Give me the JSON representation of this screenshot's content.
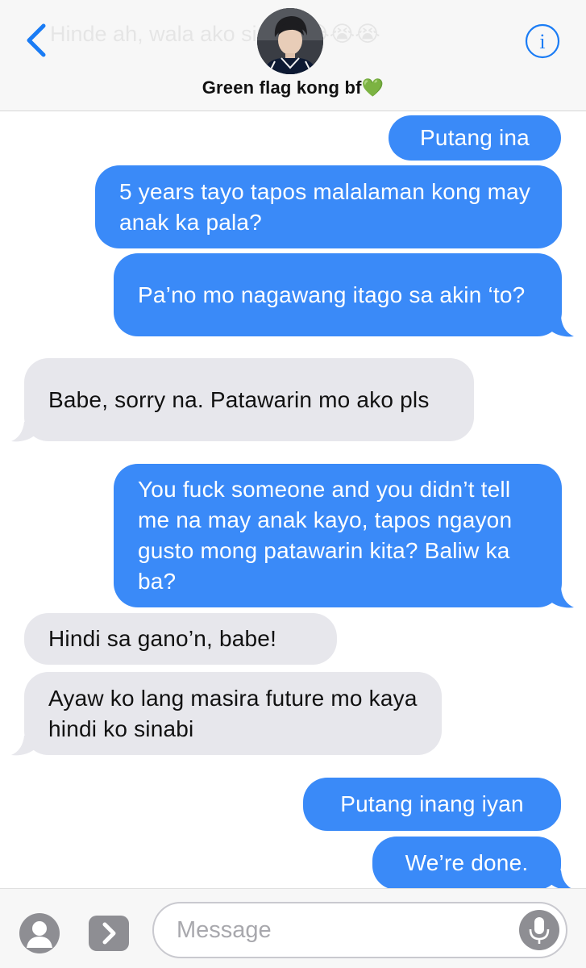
{
  "header": {
    "contact_name": "Green flag kong bf💚",
    "ghost_preview": "Hinde ah, wala ako sinabi 😭😭😭"
  },
  "messages": [
    {
      "id": 0,
      "side": "sent",
      "text": "Putang ina"
    },
    {
      "id": 1,
      "side": "sent",
      "text": "5 years tayo tapos malalaman kong may anak ka pala?"
    },
    {
      "id": 2,
      "side": "sent",
      "text": "Pa’no mo nagawang itago sa akin ‘to?"
    },
    {
      "id": 3,
      "side": "received",
      "text": "Babe, sorry na. Patawarin mo ako pls"
    },
    {
      "id": 4,
      "side": "sent",
      "text": "You fuck someone and you didn’t tell me na may anak kayo, tapos ngayon gusto mong patawarin kita? Baliw ka ba?"
    },
    {
      "id": 5,
      "side": "received",
      "text": "Hindi sa gano’n, babe!"
    },
    {
      "id": 6,
      "side": "received",
      "text": "Ayaw ko lang masira future mo kaya hindi ko sinabi"
    },
    {
      "id": 7,
      "side": "sent",
      "text": "Putang inang iyan"
    },
    {
      "id": 8,
      "side": "sent",
      "text": "We’re done."
    }
  ],
  "input": {
    "placeholder": "Message",
    "value": ""
  },
  "icons": {
    "back": "chevron-left-icon",
    "info": "info-icon",
    "camera": "camera-icon",
    "apps": "app-drawer-icon",
    "mic": "microphone-icon"
  },
  "colors": {
    "sent_bubble": "#3a8af8",
    "received_bubble": "#e7e7ec",
    "accent": "#1a7cf5"
  }
}
